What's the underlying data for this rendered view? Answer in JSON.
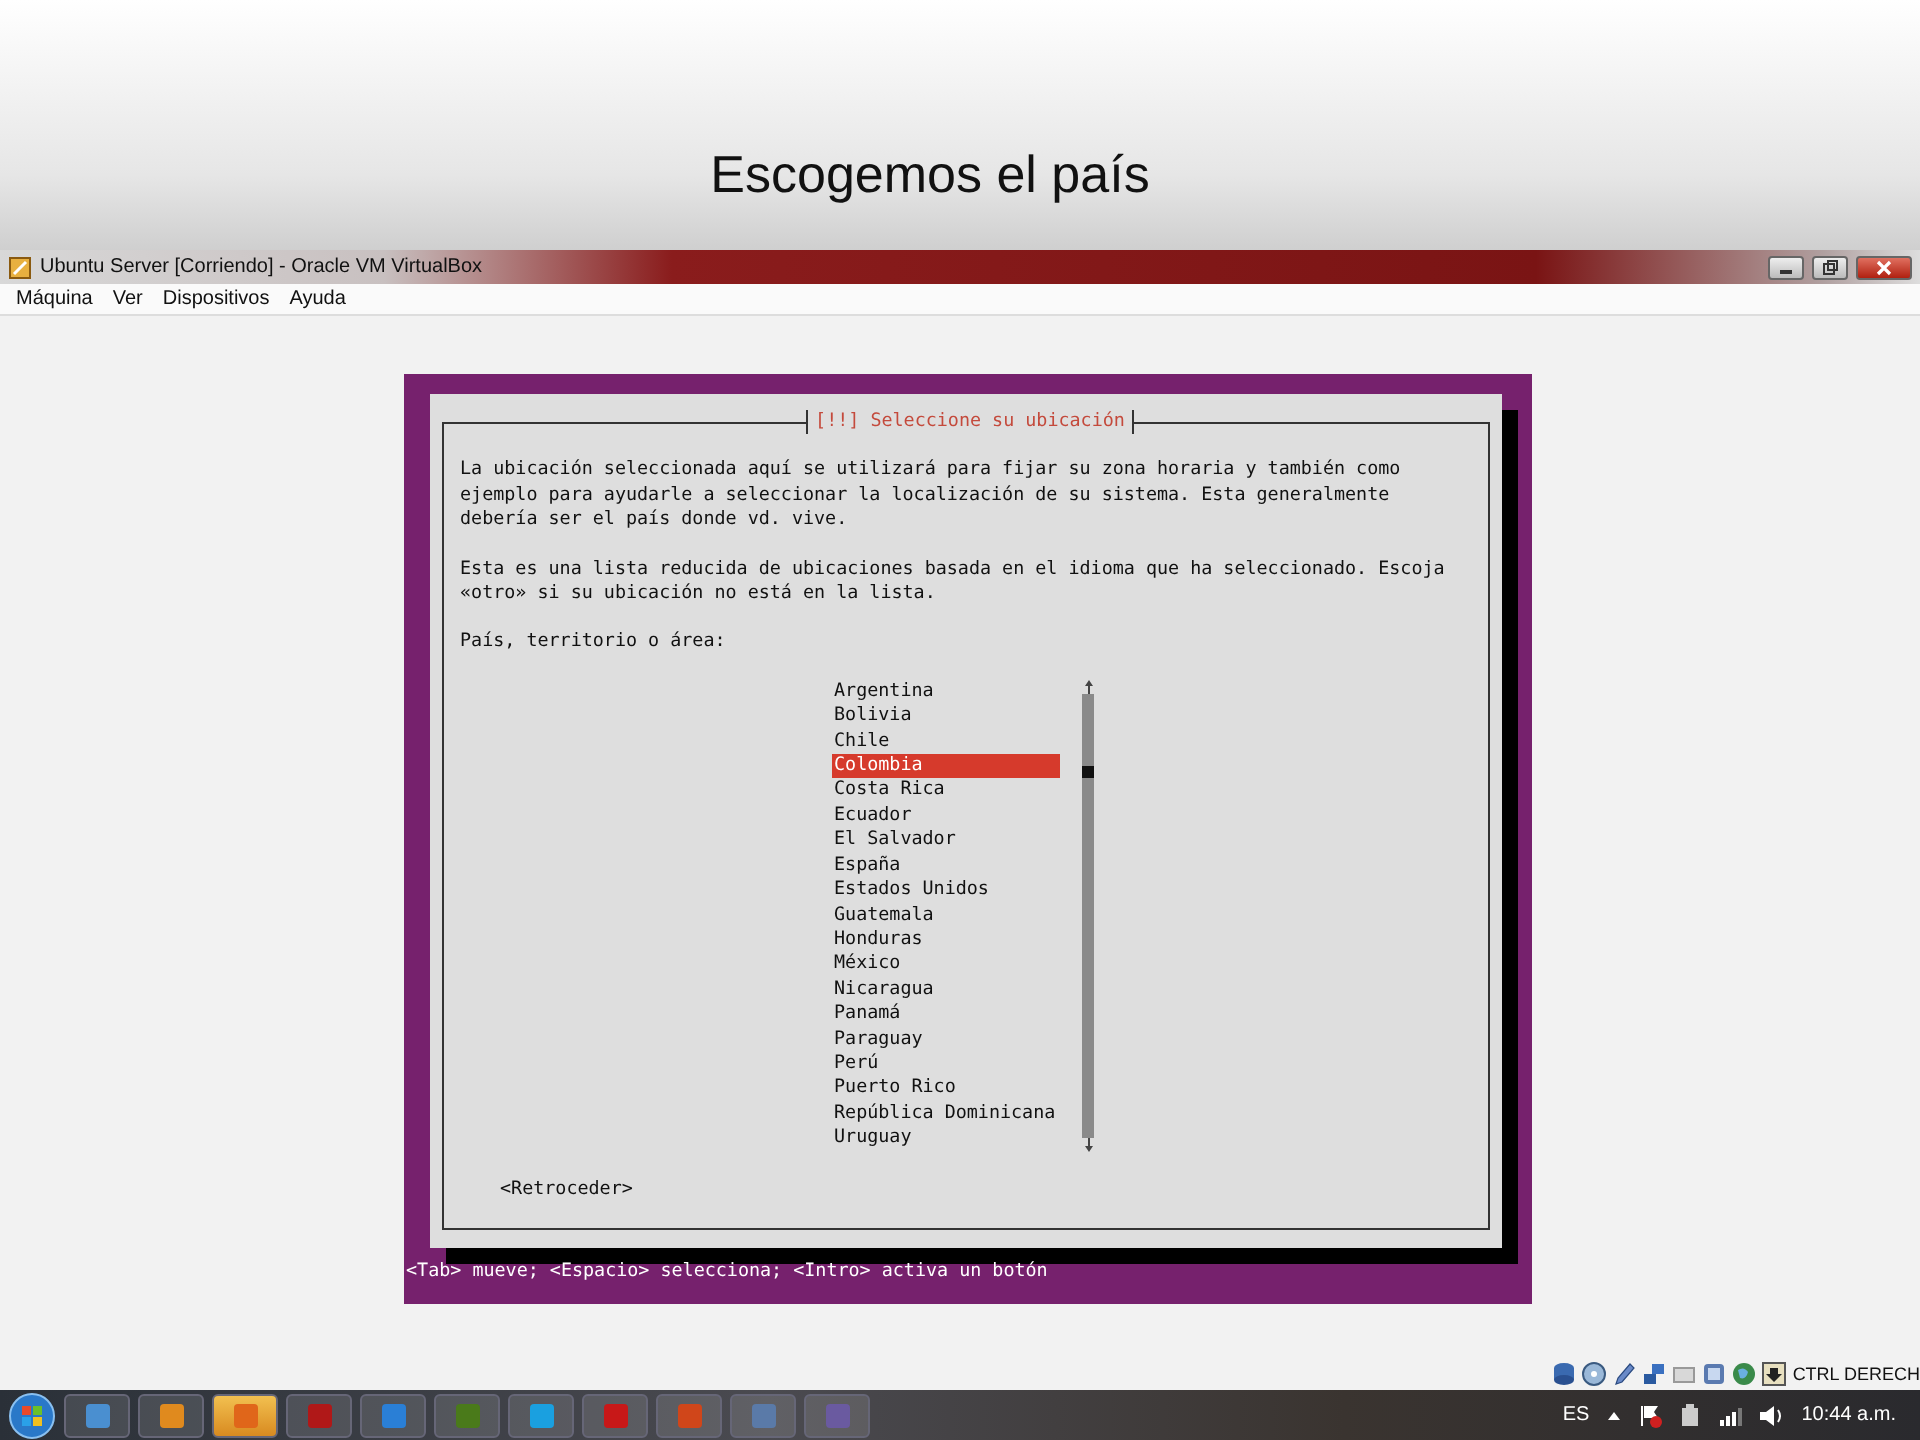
{
  "slide": {
    "title": "Escogemos el país"
  },
  "window": {
    "title": "Ubuntu Server [Corriendo] - Oracle VM VirtualBox"
  },
  "menu": [
    {
      "label": "Máquina"
    },
    {
      "label": "Ver"
    },
    {
      "label": "Dispositivos"
    },
    {
      "label": "Ayuda"
    }
  ],
  "dialog": {
    "title": "[!!] Seleccione su ubicación",
    "paragraphs": [
      "La ubicación seleccionada aquí se utilizará para fijar su zona horaria y también como ejemplo para ayudarle a seleccionar la localización de su sistema. Esta generalmente debería ser el país donde vd. vive.",
      "Esta es una lista reducida de ubicaciones basada en el idioma que ha seleccionado. Escoja «otro» si su ubicación no está en la lista."
    ],
    "prompt": "País, territorio o área:",
    "options": [
      {
        "label": "Argentina",
        "selected": false
      },
      {
        "label": "Bolivia",
        "selected": false
      },
      {
        "label": "Chile",
        "selected": false
      },
      {
        "label": "Colombia",
        "selected": true
      },
      {
        "label": "Costa Rica",
        "selected": false
      },
      {
        "label": "Ecuador",
        "selected": false
      },
      {
        "label": "El Salvador",
        "selected": false
      },
      {
        "label": "España",
        "selected": false
      },
      {
        "label": "Estados Unidos",
        "selected": false
      },
      {
        "label": "Guatemala",
        "selected": false
      },
      {
        "label": "Honduras",
        "selected": false
      },
      {
        "label": "México",
        "selected": false
      },
      {
        "label": "Nicaragua",
        "selected": false
      },
      {
        "label": "Panamá",
        "selected": false
      },
      {
        "label": "Paraguay",
        "selected": false
      },
      {
        "label": "Perú",
        "selected": false
      },
      {
        "label": "Puerto Rico",
        "selected": false
      },
      {
        "label": "República Dominicana",
        "selected": false
      },
      {
        "label": "Uruguay",
        "selected": false
      }
    ],
    "back_button": "<Retroceder>"
  },
  "help_line": "<Tab> mueve; <Espacio> selecciona; <Intro> activa un botón",
  "vm_status": {
    "host_key": "CTRL DERECH"
  },
  "taskbar": {
    "apps": [
      {
        "color": "#4a8fd0",
        "selected": false
      },
      {
        "color": "#e08a1e",
        "selected": false
      },
      {
        "color": "#e0661a",
        "selected": true
      },
      {
        "color": "#b01818",
        "selected": false
      },
      {
        "color": "#2a7fd6",
        "selected": false
      },
      {
        "color": "#4a7a1a",
        "selected": false
      },
      {
        "color": "#1aa0e0",
        "selected": false
      },
      {
        "color": "#c81818",
        "selected": false
      },
      {
        "color": "#d0461a",
        "selected": false
      },
      {
        "color": "#5a7aa8",
        "selected": false
      },
      {
        "color": "#6a5aa0",
        "selected": false
      }
    ],
    "language": "ES",
    "clock": "10:44 a.m."
  }
}
